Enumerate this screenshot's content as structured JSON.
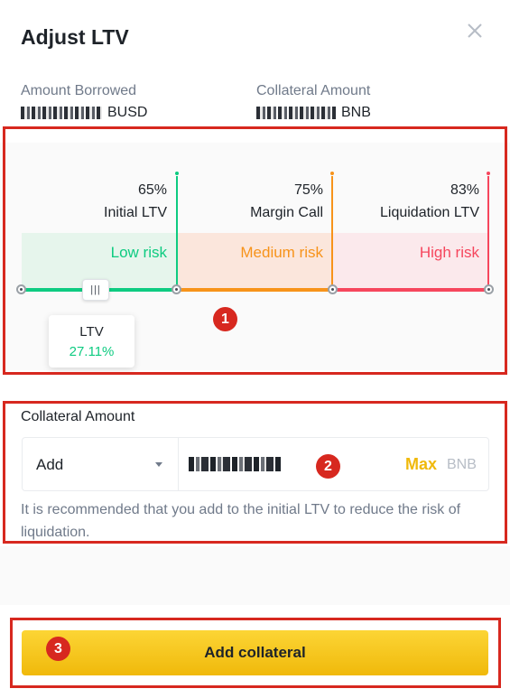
{
  "dialog": {
    "title": "Adjust LTV"
  },
  "summary": {
    "borrowed_label": "Amount Borrowed",
    "borrowed_unit": "BUSD",
    "collateral_label": "Collateral Amount",
    "collateral_unit": "BNB"
  },
  "ltv_scale": {
    "thresholds": [
      {
        "percent": "65%",
        "name": "Initial LTV",
        "color": "#0ecb81"
      },
      {
        "percent": "75%",
        "name": "Margin Call",
        "color": "#f7931a"
      },
      {
        "percent": "83%",
        "name": "Liquidation LTV",
        "color": "#f6465d"
      }
    ],
    "zones": [
      {
        "label": "Low risk",
        "color": "#0ecb81"
      },
      {
        "label": "Medium risk",
        "color": "#f7931a"
      },
      {
        "label": "High risk",
        "color": "#f6465d"
      }
    ],
    "current_label": "LTV",
    "current_value": "27.11%",
    "handle_glyph": "|||"
  },
  "collateral_form": {
    "label": "Collateral Amount",
    "action_selected": "Add",
    "max_label": "Max",
    "unit": "BNB",
    "hint": "It is recommended that you add to the initial LTV to reduce the risk of liquidation."
  },
  "annotations": {
    "badge_1": "1",
    "badge_2": "2",
    "badge_3": "3",
    "color": "#d7281f"
  },
  "submit": {
    "label": "Add collateral"
  },
  "icons": {
    "close": "close-icon",
    "dropdown": "chevron-down-icon"
  },
  "colors": {
    "accent": "#f0b90b",
    "positive": "#0ecb81",
    "text_secondary": "#707a8a"
  }
}
